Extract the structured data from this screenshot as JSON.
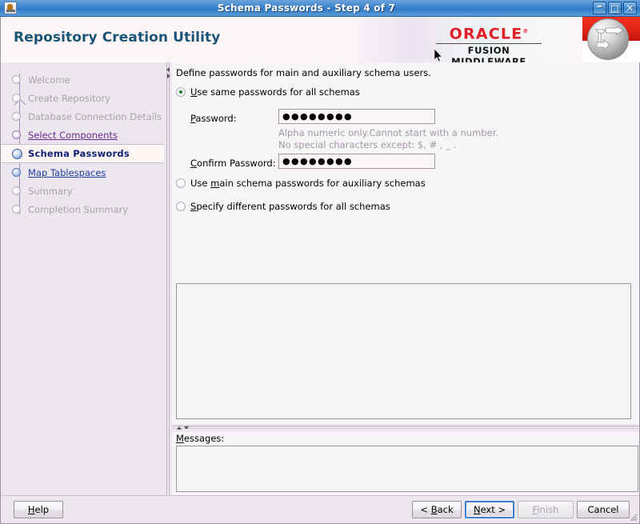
{
  "window": {
    "title": "Schema Passwords - Step 4 of 7",
    "app_icon": "java-coffee-cup-icon",
    "minimize_label": "–",
    "maximize_label": "□",
    "close_label": "✕"
  },
  "banner": {
    "product_title": "Repository Creation Utility",
    "brand": "ORACLE",
    "brand_trademark": "®",
    "brand_sub": "FUSION MIDDLEWARE",
    "logo_icon": "oracle-fusion-middleware-logo"
  },
  "sidebar": {
    "items": [
      {
        "label": "Welcome",
        "state": "done",
        "style": "disabled"
      },
      {
        "label": "Create Repository",
        "state": "done",
        "style": "disabled"
      },
      {
        "label": "Database Connection Details",
        "state": "done",
        "style": "disabled"
      },
      {
        "label": "Select Components",
        "state": "visited",
        "style": "link-purple"
      },
      {
        "label": "Schema Passwords",
        "state": "active",
        "style": "active"
      },
      {
        "label": "Map Tablespaces",
        "state": "next",
        "style": "link-blue"
      },
      {
        "label": "Summary",
        "state": "todo",
        "style": "disabled"
      },
      {
        "label": "Completion Summary",
        "state": "todo",
        "style": "disabled"
      }
    ]
  },
  "main": {
    "intro": "Define passwords for main and auxiliary schema users.",
    "options": [
      {
        "label_pre": "U",
        "label_mn": "",
        "label": "Use same passwords for all schemas",
        "mnemonic": "U",
        "selected": true
      },
      {
        "label": "Use main schema passwords for auxiliary schemas",
        "mnemonic": "m",
        "selected": false
      },
      {
        "label": "Specify different passwords for all schemas",
        "mnemonic": "S",
        "selected": false
      }
    ],
    "password_label": "Password:",
    "password_value": "●●●●●●●●",
    "hint_line1": "Alpha numeric only.Cannot start with a number.",
    "hint_line2": "No special characters except: $, # , _ .",
    "confirm_label": "Confirm Password:",
    "confirm_value": "●●●●●●●●",
    "detail_panel_content": ""
  },
  "messages": {
    "label": "Messages:",
    "content": ""
  },
  "footer": {
    "help_label": "Help",
    "back_label": "< Back",
    "next_label": "Next >",
    "finish_label": "Finish",
    "cancel_label": "Cancel",
    "finish_disabled": true,
    "next_focused": true
  },
  "colors": {
    "titlebar_blue": "#3c84ce",
    "oracle_red": "#e01f26",
    "active_nav": "#10217a",
    "visited_link": "#6a2a8d",
    "next_link": "#1c3fa0",
    "radio_dot_green": "#1f7a1f",
    "window_bg": "#ece7ee",
    "pane_bg": "#f7f5f7"
  }
}
